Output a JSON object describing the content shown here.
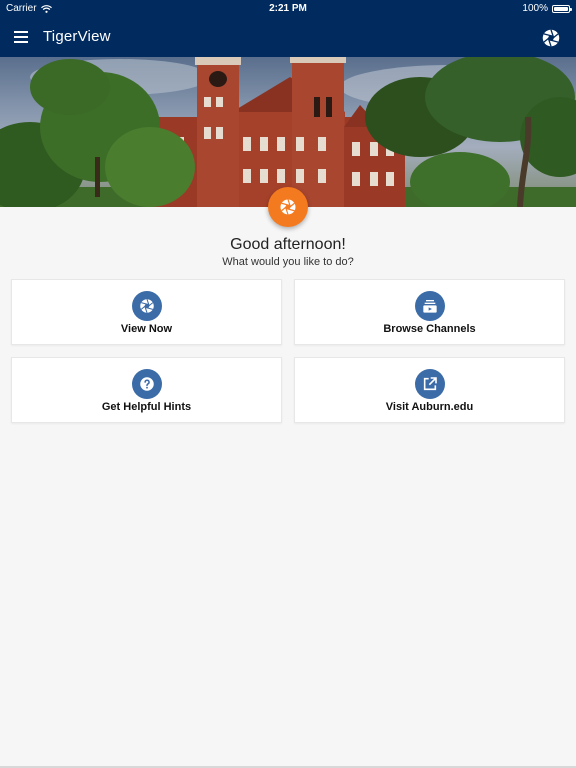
{
  "status_bar": {
    "carrier": "Carrier",
    "time": "2:21 PM",
    "battery": "100%"
  },
  "app_bar": {
    "title": "TigerView",
    "menu_icon": "hamburger-menu-icon",
    "action_icon": "camera-aperture-icon"
  },
  "colors": {
    "primary": "#012a5e",
    "accent": "#f47a20",
    "icon_circle": "#3c6ca8",
    "background": "#f6f6f6"
  },
  "main": {
    "greeting": "Good afternoon!",
    "prompt": "What would you like to do?",
    "fab_icon": "camera-aperture-icon",
    "actions": [
      {
        "label": "View Now",
        "icon": "camera-aperture-icon"
      },
      {
        "label": "Browse Channels",
        "icon": "channels-icon"
      },
      {
        "label": "Get Helpful Hints",
        "icon": "help-icon"
      },
      {
        "label": "Visit Auburn.edu",
        "icon": "open-external-icon"
      }
    ]
  }
}
